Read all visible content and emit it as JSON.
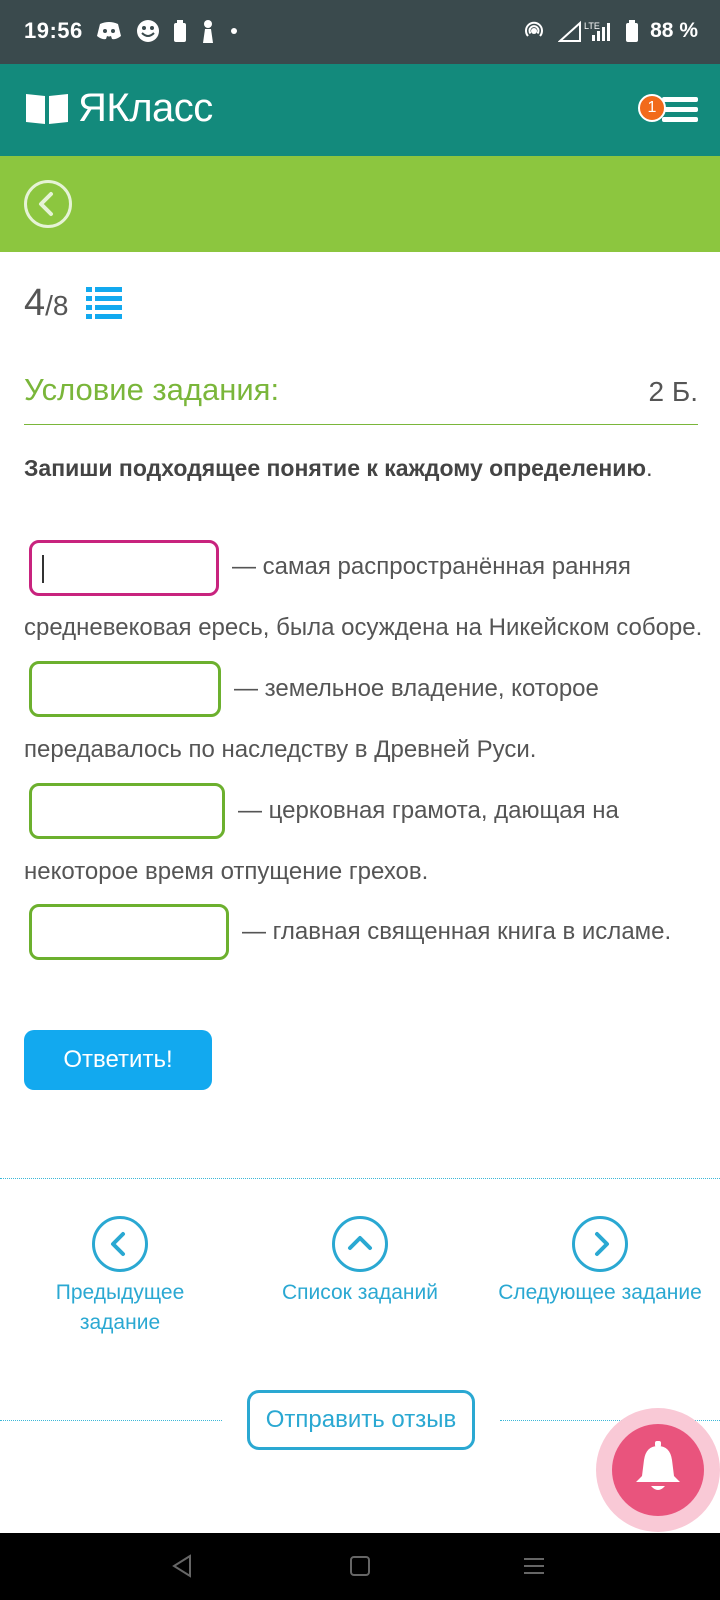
{
  "status_bar": {
    "time": "19:56",
    "battery_percent": "88 %",
    "icons_left": [
      "discord-icon",
      "smiley-icon",
      "battery-saver-icon",
      "figure-icon",
      "dot-icon"
    ],
    "icons_right": [
      "hotspot-icon",
      "lte-signal-icon",
      "battery-icon"
    ]
  },
  "header": {
    "logo_text": "ЯКласс",
    "notification_count": "1"
  },
  "counter": {
    "current": "4",
    "separator": "/",
    "total": "8"
  },
  "condition": {
    "title": "Условие задания:",
    "points": "2 Б.",
    "instruction": "Запиши подходящее понятие к каждому определению",
    "instruction_end": "."
  },
  "questions": [
    {
      "value": "",
      "text_line1": "— самая распространённая ранняя",
      "text_line2": "средневековая ересь, была осуждена на Никейском соборе."
    },
    {
      "value": "",
      "text_line1": "— земельное владение, которое",
      "text_line2": "передавалось по наследству в Древней Руси."
    },
    {
      "value": "",
      "text_line1": "— церковная грамота, дающая на",
      "text_line2": "некоторое время отпущение грехов."
    },
    {
      "value": "",
      "text_line1": "— главная священная книга в исламе."
    }
  ],
  "submit_label": "Ответить!",
  "nav": {
    "prev_line1": "Предыдущее",
    "prev_line2": "задание",
    "list": "Список заданий",
    "next": "Следующее задание"
  },
  "feedback_label": "Отправить отзыв",
  "colors": {
    "header": "#138a7c",
    "subheader": "#8cc63f",
    "accent_green": "#7ab63a",
    "link_blue": "#2aa8d2",
    "button_blue": "#12a9ef",
    "active_input": "#c8237e",
    "badge": "#f26a1b",
    "bell": "#e9547d"
  }
}
